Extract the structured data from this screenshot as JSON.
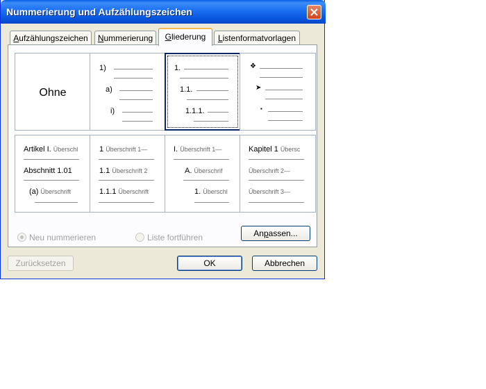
{
  "window": {
    "title": "Nummerierung und Aufzählungszeichen"
  },
  "tabs": [
    {
      "pre": "",
      "u": "A",
      "post": "ufzählungszeichen"
    },
    {
      "pre": "",
      "u": "N",
      "post": "ummerierung"
    },
    {
      "pre": "",
      "u": "G",
      "post": "liederung"
    },
    {
      "pre": "",
      "u": "L",
      "post": "istenformatvorlagen"
    }
  ],
  "active_tab": "Gliederung",
  "tiles": {
    "none": {
      "label": "Ohne"
    },
    "numbered": {
      "l1": "1)",
      "l2": "a)",
      "l3": "i)"
    },
    "decimal": {
      "l1": "1.",
      "l2": "1.1.",
      "l3": "1.1.1."
    },
    "symbols": {
      "l1": "❖",
      "l2": "➤",
      "l3": "▪"
    },
    "artikel": {
      "l1": "Artikel I.",
      "l1s": "Überschl",
      "l2": "Abschnitt 1.01",
      "l3": "(a)",
      "l3s": "Überschrift"
    },
    "heading_num": {
      "l1": "1",
      "l1s": "Überschrift 1—",
      "l2": "1.1",
      "l2s": "Überschrift 2",
      "l3": "1.1.1",
      "l3s": "Überschrift"
    },
    "heading_roman": {
      "l1": "I.",
      "l1s": "Überschrift 1—",
      "l2": "A.",
      "l2s": "Überschrif",
      "l3": "1.",
      "l3s": "Überschl"
    },
    "kapitel": {
      "l1": "Kapitel 1",
      "l1s": "Übersc",
      "l2s": "Überschrift 2—",
      "l3s": "Überschrift 3—"
    }
  },
  "options": {
    "restart": "Neu nummerieren",
    "continue": "Liste fortführen",
    "customize": {
      "pre": "An",
      "u": "p",
      "post": "assen..."
    }
  },
  "buttons": {
    "reset": "Zurücksetzen",
    "ok": "OK",
    "cancel": "Abbrechen"
  },
  "colors": {
    "titlebar": "#0a5fe6",
    "dialog_bg": "#ece9d8",
    "active_tab_accent": "#f6b84e",
    "close_button": "#d2431c"
  }
}
